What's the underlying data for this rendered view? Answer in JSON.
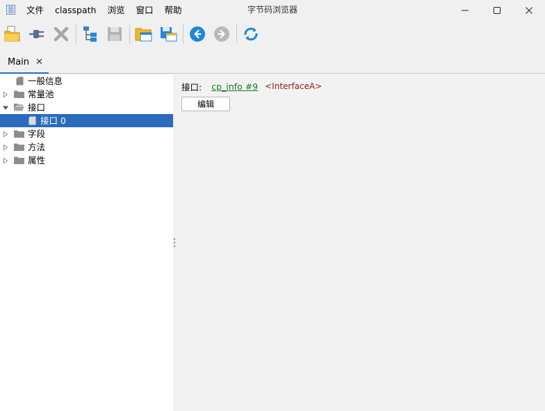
{
  "menu": [
    "文件",
    "classpath",
    "浏览",
    "窗口",
    "帮助"
  ],
  "window": {
    "title": "字节码浏览器"
  },
  "tab": {
    "label": "Main",
    "close": "✕"
  },
  "tree": [
    {
      "label": "一般信息",
      "icon": "file-icon",
      "expandable": false,
      "indent": 0,
      "selected": false
    },
    {
      "label": "常量池",
      "icon": "folder-icon",
      "expandable": true,
      "expanded": false,
      "indent": 0,
      "selected": false
    },
    {
      "label": "接口",
      "icon": "folder-open-icon",
      "expandable": true,
      "expanded": true,
      "indent": 0,
      "selected": false
    },
    {
      "label": "接口 0",
      "icon": "file-icon",
      "expandable": false,
      "indent": 1,
      "selected": true
    },
    {
      "label": "字段",
      "icon": "folder-icon",
      "expandable": true,
      "expanded": false,
      "indent": 0,
      "selected": false
    },
    {
      "label": "方法",
      "icon": "folder-icon",
      "expandable": true,
      "expanded": false,
      "indent": 0,
      "selected": false
    },
    {
      "label": "属性",
      "icon": "folder-icon",
      "expandable": true,
      "expanded": false,
      "indent": 0,
      "selected": false
    }
  ],
  "detail": {
    "label": "接口:",
    "link": "cp_info #9",
    "interface_name": "<InterfaceA>",
    "edit_button": "编辑"
  },
  "colors": {
    "selection": "#2a6cbb",
    "link": "#167a16",
    "name": "#8b1a1a",
    "accent": "#1e88d8"
  }
}
